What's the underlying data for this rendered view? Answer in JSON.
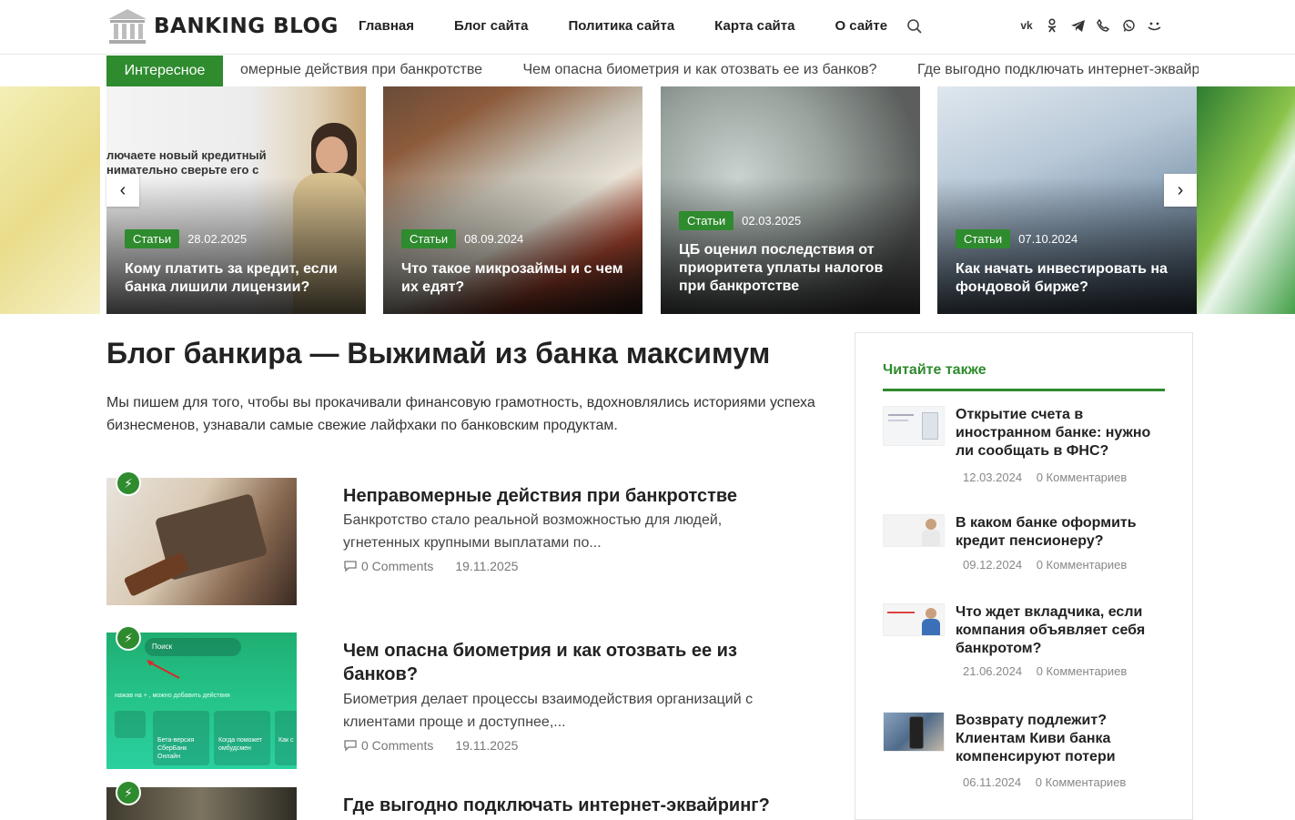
{
  "header": {
    "logo_text": "BANKING BLOG",
    "nav": [
      "Главная",
      "Блог сайта",
      "Политика сайта",
      "Карта сайта",
      "О сайте"
    ],
    "socials": [
      "vk-icon",
      "ok-icon",
      "telegram-icon",
      "viber-icon",
      "whatsapp-icon",
      "mymail-icon"
    ]
  },
  "ticker": {
    "label": "Интересное",
    "items": [
      "омерные действия при банкротстве",
      "Чем опасна биометрия и как отозвать ее из банков?",
      "Где выгодно подключать интернет-эквайринг?"
    ]
  },
  "slider": {
    "slides": [
      {
        "badge": "Статьи",
        "date": "28.02.2025",
        "title": "Кому платить за кредит, если банка лишили лицензии?",
        "overlay": "лючаете новый кредитный\nнимательно сверьте его с"
      },
      {
        "badge": "Статьи",
        "date": "08.09.2024",
        "title": "Что такое микрозаймы и с чем их едят?"
      },
      {
        "badge": "Статьи",
        "date": "02.03.2025",
        "title": "ЦБ оценил последствия от приоритета уплаты налогов при банкротстве"
      },
      {
        "badge": "Статьи",
        "date": "07.10.2024",
        "title": "Как начать инвестировать на фондовой бирже?"
      }
    ]
  },
  "main": {
    "title": "Блог банкира — Выжимай из банка максимум",
    "intro": "Мы пишем для того, чтобы вы прокачивали финансовую грамотность, вдохновлялись историями успеха бизнесменов, узнавали самые свежие лайфхаки по банковским продуктам.",
    "posts": [
      {
        "title": "Неправомерные действия при банкротстве",
        "excerpt": "Банкротство стало реальной возможностью для людей, угнетенных крупными выплатами по...",
        "comments": "0 Comments",
        "date": "19.11.2025"
      },
      {
        "title": "Чем опасна биометрия и как отозвать ее из банков?",
        "excerpt": "Биометрия делает процессы взаимодействия организаций с клиентами проще и доступнее,...",
        "comments": "0 Comments",
        "date": "19.11.2025",
        "thumb_search": "Поиск",
        "thumb_hint": "нажав на + , можно добавить действия",
        "thumb_cards": [
          "Бета-версия СберБанк Онлайн",
          "Когда поможет омбудсмен",
          "Как с"
        ]
      },
      {
        "title": "Где выгодно подключать интернет-эквайринг?"
      }
    ]
  },
  "sidebar": {
    "title": "Читайте также",
    "items": [
      {
        "title": "Открытие счета в иностранном банке: нужно ли сообщать в ФНС?",
        "date": "12.03.2024",
        "comments": "0 Комментариев"
      },
      {
        "title": "В каком банке оформить кредит пенсионеру?",
        "date": "09.12.2024",
        "comments": "0 Комментариев"
      },
      {
        "title": "Что ждет вкладчика, если компания объявляет себя банкротом?",
        "date": "21.06.2024",
        "comments": "0 Комментариев"
      },
      {
        "title": "Возврату подлежит? Клиентам Киви банка компенсируют потери",
        "date": "06.11.2024",
        "comments": "0 Комментариев"
      }
    ]
  },
  "colors": {
    "accent": "#2e8b2e",
    "text": "#222222",
    "muted": "#888888"
  }
}
